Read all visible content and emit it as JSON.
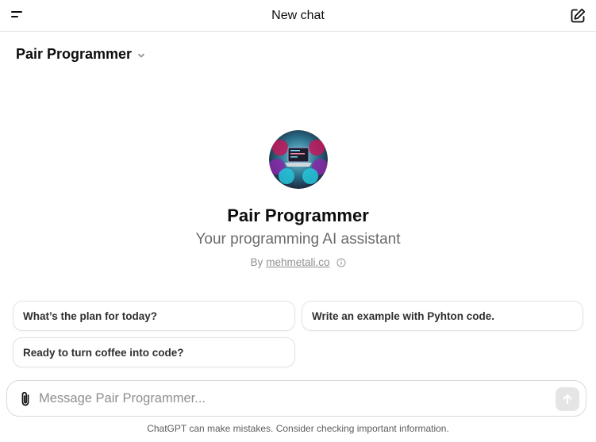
{
  "header": {
    "title": "New chat"
  },
  "model_selector": {
    "label": "Pair Programmer"
  },
  "gpt": {
    "name": "Pair Programmer",
    "description": "Your programming AI assistant",
    "by_prefix": "By",
    "author": "mehmetali.co"
  },
  "prompts": [
    {
      "label": "What’s the plan for today?"
    },
    {
      "label": "Write an example with Pyhton code."
    },
    {
      "label": "Ready to turn coffee into code?"
    }
  ],
  "composer": {
    "placeholder": "Message Pair Programmer..."
  },
  "footer": {
    "disclaimer": "ChatGPT can make mistakes. Consider checking important information."
  },
  "icons": {
    "menu": "menu-icon",
    "new_chat": "edit-icon",
    "chevron": "chevron-down-icon",
    "info": "info-icon",
    "attach": "paperclip-icon",
    "send": "arrow-up-icon"
  },
  "colors": {
    "text": "#0d0d0d",
    "muted": "#6b6b6b",
    "border": "#e3e3e3",
    "send_bg": "#e5e5e5"
  }
}
